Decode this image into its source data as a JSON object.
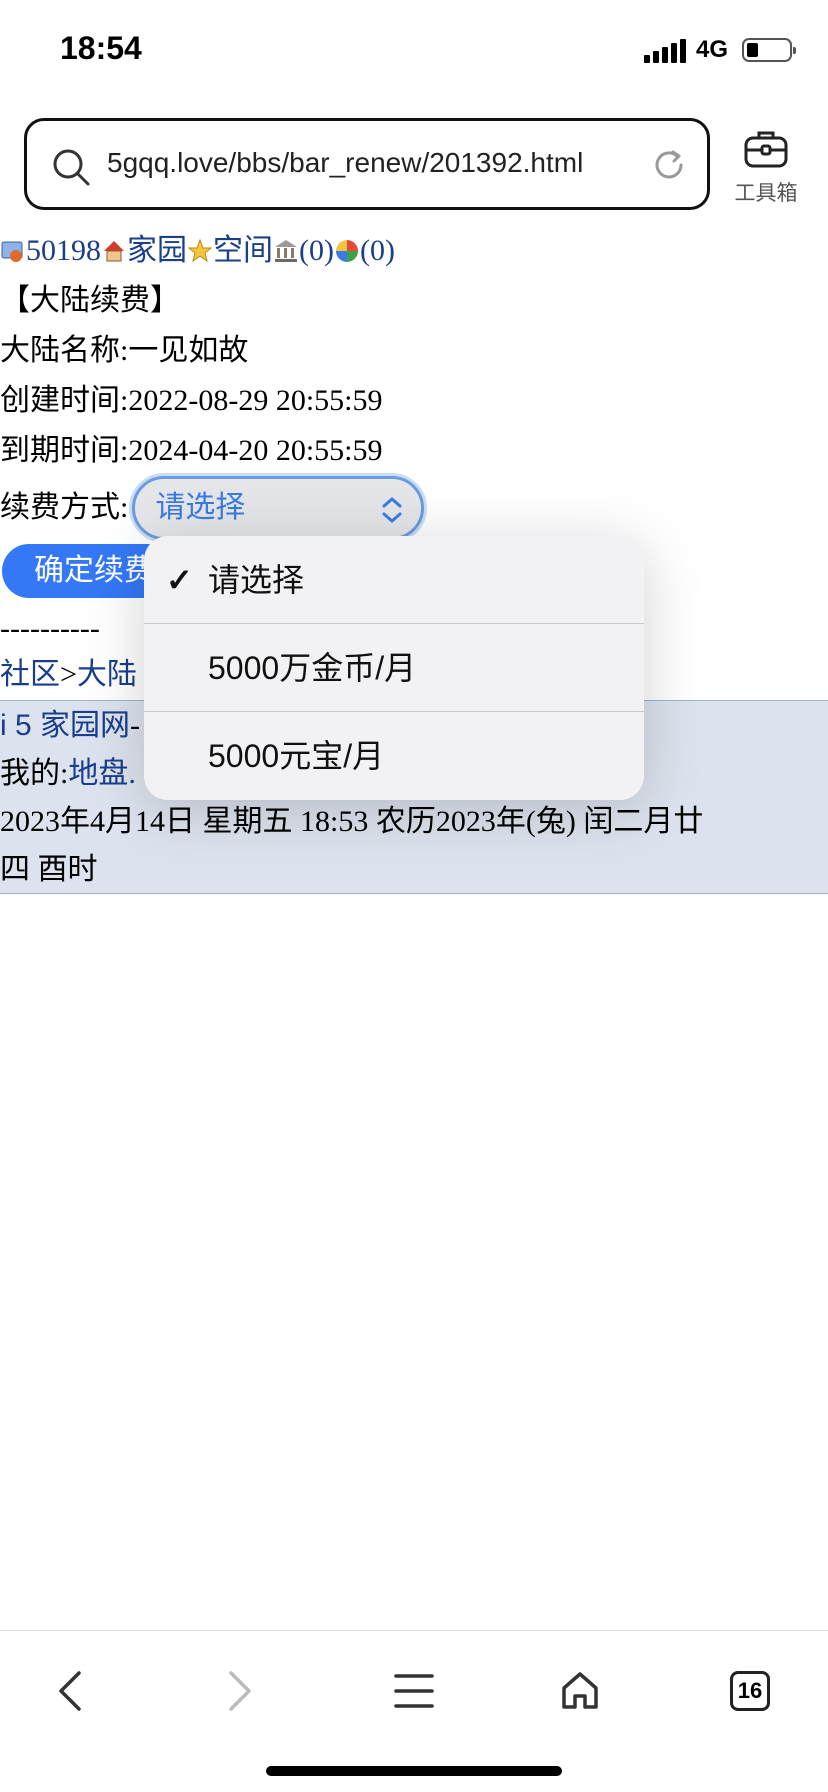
{
  "status_bar": {
    "time": "18:54",
    "network": "4G"
  },
  "browser": {
    "url": "5gqq.love/bbs/bar_renew/201392.html",
    "toolbox_label": "工具箱",
    "tab_count": "16"
  },
  "nav": {
    "user_id": "50198",
    "home_link": "家园",
    "space_link": "空间",
    "count_a": "(0)",
    "count_b": "(0)"
  },
  "page": {
    "heading": "【大陆续费】",
    "name_line": "大陆名称:一见如故",
    "created_line": "创建时间:2022-08-29 20:55:59",
    "expire_line": "到期时间:2024-04-20 20:55:59",
    "renew_label": "续费方式:",
    "select_value": "请选择",
    "confirm_button": "确定续费",
    "divider": "----------",
    "breadcrumb_community": "社区",
    "breadcrumb_sep": ">",
    "breadcrumb_mainland": "大陆"
  },
  "footer": {
    "site_link": "i 5 家园网",
    "site_suffix": "-",
    "my_label": "我的:",
    "my_link": "地盘.",
    "datetime_line1": "2023年4月14日  星期五  18:53  农历2023年(兔)  闰二月廿",
    "datetime_line2": "四  酉时"
  },
  "dropdown": {
    "options": [
      {
        "label": "请选择",
        "selected": true,
        "check": "✓"
      },
      {
        "label": "5000万金币/月",
        "selected": false
      },
      {
        "label": "5000元宝/月",
        "selected": false
      }
    ]
  },
  "colors": {
    "link": "#1a3e8c",
    "accent": "#3478f6",
    "footer_bg": "#dde3ee"
  }
}
